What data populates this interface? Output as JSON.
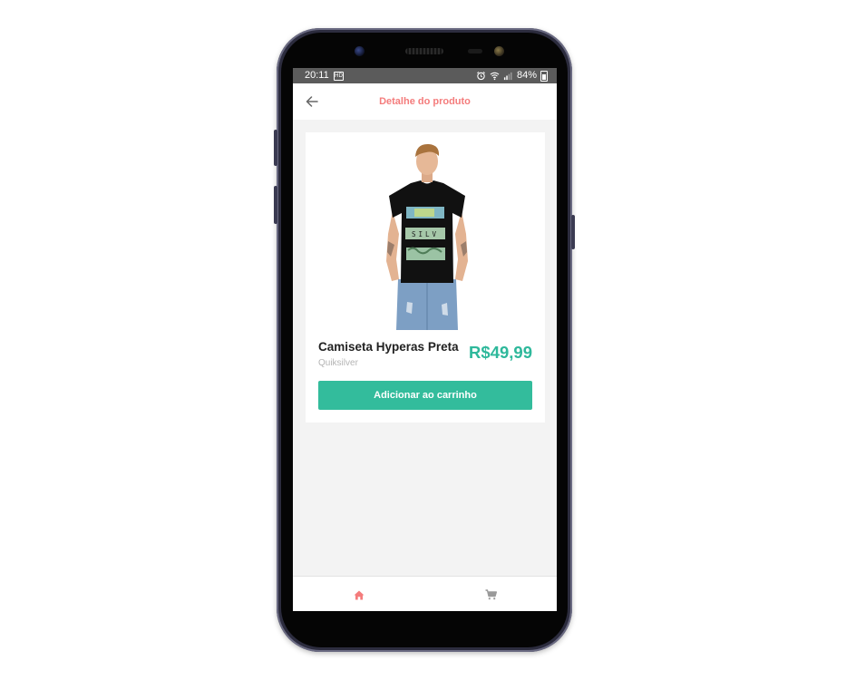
{
  "status_bar": {
    "time": "20:11",
    "notification_icon": "HD",
    "battery": "84%",
    "icons": [
      "alarm-icon",
      "wifi-icon",
      "signal-icon",
      "battery-icon"
    ]
  },
  "app_bar": {
    "title": "Detalhe do produto",
    "back_icon": "arrow-left-icon"
  },
  "product": {
    "name": "Camiseta Hyperas Preta",
    "brand": "Quiksilver",
    "price": "R$49,99",
    "image": "product-photo"
  },
  "actions": {
    "add_to_cart_label": "Adicionar ao carrinho"
  },
  "bottom_nav": {
    "items": [
      {
        "name": "home",
        "icon": "home-icon",
        "active": true
      },
      {
        "name": "cart",
        "icon": "cart-icon",
        "active": false
      }
    ]
  },
  "colors": {
    "accent": "#f47c7c",
    "price": "#2eb89b",
    "button": "#33bc9c",
    "inactive_icon": "#9a9a9a",
    "background": "#f3f3f3"
  }
}
